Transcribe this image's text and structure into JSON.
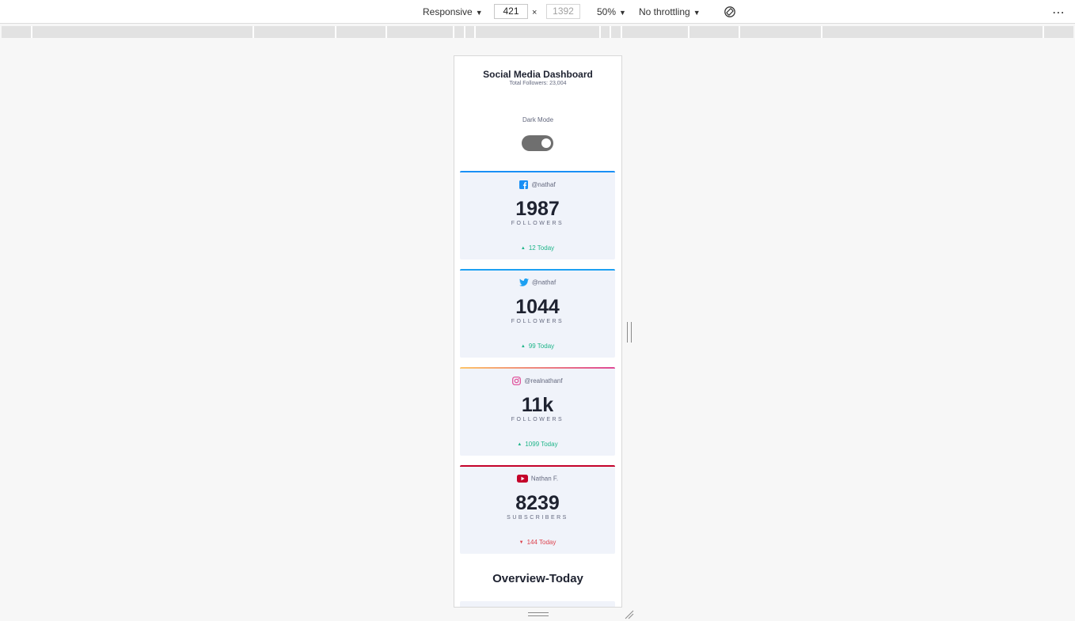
{
  "toolbar": {
    "device_mode": "Responsive",
    "width": "421",
    "separator": "×",
    "height_placeholder": "1392",
    "zoom": "50%",
    "throttling": "No throttling"
  },
  "page": {
    "title": "Social Media Dashboard",
    "subtitle": "Total Followers: 23,004",
    "dark_mode_label": "Dark Mode",
    "overview_title": "Overview-Today"
  },
  "cards": [
    {
      "platform": "facebook",
      "icon": "facebook-icon",
      "handle": "@nathaf",
      "count": "1987",
      "label": "FOLLOWERS",
      "delta": "12 Today",
      "trend": "up",
      "accent": "#198ff5"
    },
    {
      "platform": "twitter",
      "icon": "twitter-icon",
      "handle": "@nathaf",
      "count": "1044",
      "label": "FOLLOWERS",
      "delta": "99 Today",
      "trend": "up",
      "accent": "#1ca0f2"
    },
    {
      "platform": "instagram",
      "icon": "instagram-icon",
      "handle": "@realnathanf",
      "count": "11k",
      "label": "FOLLOWERS",
      "delta": "1099 Today",
      "trend": "up",
      "accent": "#fdc468"
    },
    {
      "platform": "youtube",
      "icon": "youtube-icon",
      "handle": "Nathan F.",
      "count": "8239",
      "label": "SUBSCRIBERS",
      "delta": "144 Today",
      "trend": "down",
      "accent": "#c4032a"
    }
  ],
  "colors": {
    "up": "#1eb589",
    "down": "#dc414c",
    "facebook": "#198ff5",
    "twitter": "#1ca0f2",
    "instagram_start": "#fdc468",
    "instagram_end": "#df4996",
    "youtube": "#c4032a"
  }
}
